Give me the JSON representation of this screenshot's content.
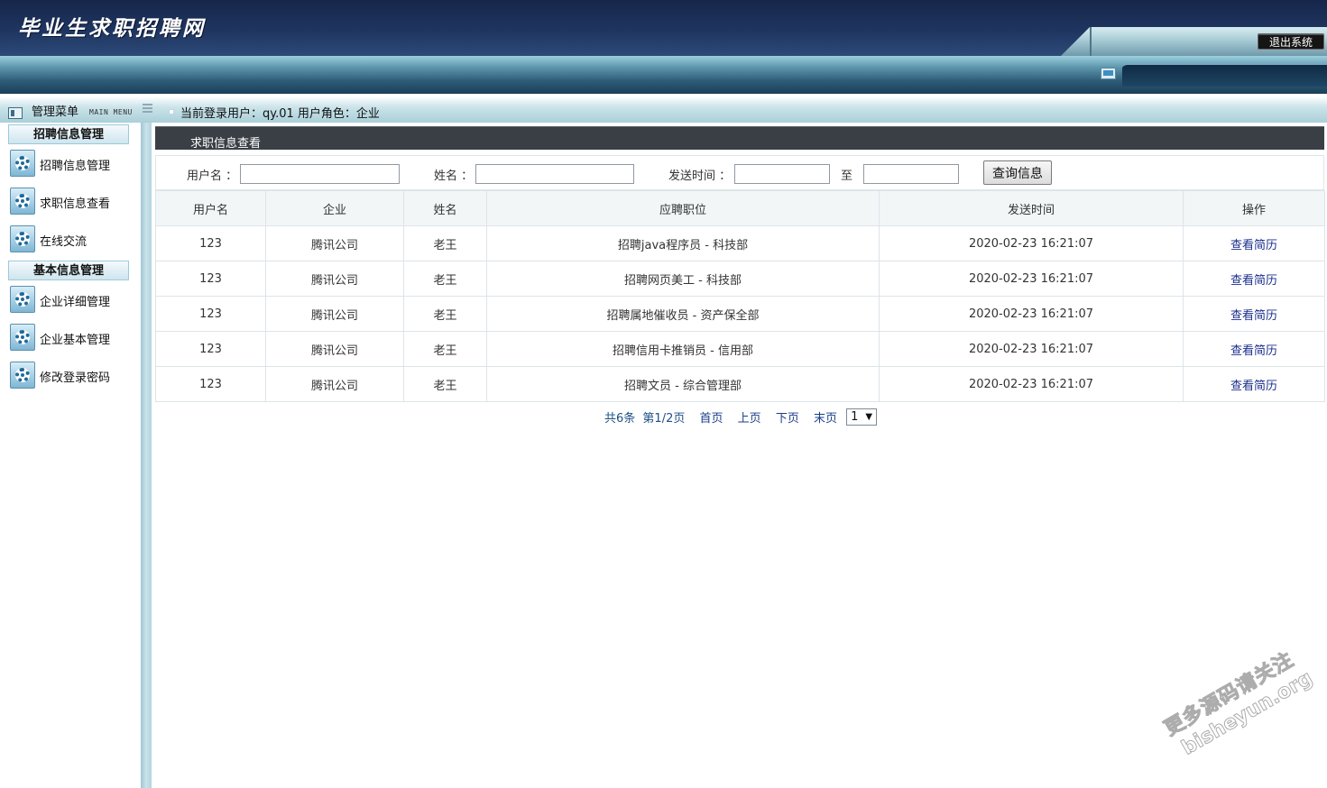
{
  "header": {
    "title": "毕业生求职招聘网",
    "logout_label": "退出系统"
  },
  "menu": {
    "title": "管理菜单",
    "title_en": "MAIN MENU",
    "groups": [
      {
        "label": "招聘信息管理",
        "items": [
          {
            "label": "招聘信息管理",
            "icon": "gear-icon"
          },
          {
            "label": "求职信息查看",
            "icon": "gear-icon"
          },
          {
            "label": "在线交流",
            "icon": "gear-icon"
          }
        ]
      },
      {
        "label": "基本信息管理",
        "items": [
          {
            "label": "企业详细管理",
            "icon": "gear-icon"
          },
          {
            "label": "企业基本管理",
            "icon": "gear-icon"
          },
          {
            "label": "修改登录密码",
            "icon": "gear-icon"
          }
        ]
      }
    ]
  },
  "user_bar": {
    "text": "当前登录用户：qy.01  用户角色：企业"
  },
  "panel": {
    "title": "求职信息查看"
  },
  "search": {
    "username_label": "用户名 ：",
    "username_value": "",
    "name_label": "姓名 ：",
    "name_value": "",
    "time_label": "发送时间 ：",
    "time_from_value": "",
    "to_label": "至",
    "time_to_value": "",
    "submit_label": "查询信息"
  },
  "table": {
    "columns": [
      "用户名",
      "企业",
      "姓名",
      "应聘职位",
      "发送时间",
      "操作"
    ],
    "rows": [
      {
        "username": "123",
        "company": "腾讯公司",
        "name": "老王",
        "position": "招聘java程序员 - 科技部",
        "time": "2020-02-23 16:21:07",
        "action": "查看简历"
      },
      {
        "username": "123",
        "company": "腾讯公司",
        "name": "老王",
        "position": "招聘网页美工 - 科技部",
        "time": "2020-02-23 16:21:07",
        "action": "查看简历"
      },
      {
        "username": "123",
        "company": "腾讯公司",
        "name": "老王",
        "position": "招聘属地催收员 - 资产保全部",
        "time": "2020-02-23 16:21:07",
        "action": "查看简历"
      },
      {
        "username": "123",
        "company": "腾讯公司",
        "name": "老王",
        "position": "招聘信用卡推销员 - 信用部",
        "time": "2020-02-23 16:21:07",
        "action": "查看简历"
      },
      {
        "username": "123",
        "company": "腾讯公司",
        "name": "老王",
        "position": "招聘文员 - 综合管理部",
        "time": "2020-02-23 16:21:07",
        "action": "查看简历"
      }
    ]
  },
  "pager": {
    "total": "共6条",
    "page_info": "第1/2页",
    "first": "首页",
    "prev": "上页",
    "next": "下页",
    "last": "末页",
    "selected_page": "1"
  },
  "watermark": {
    "line1": "更多源码请关注",
    "line2": "bisheyun.org"
  }
}
